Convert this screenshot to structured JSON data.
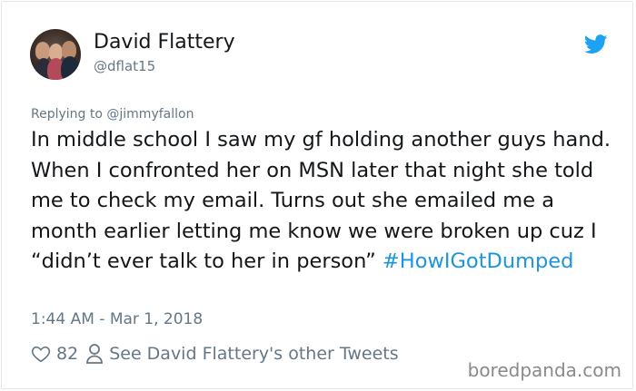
{
  "author": {
    "name": "David Flattery",
    "handle": "@dflat15"
  },
  "reply": {
    "prefix": "Replying to ",
    "mention": "@jimmyfallon"
  },
  "tweet": {
    "text": "In middle school I saw my gf holding another guys hand. When I confronted her on MSN later that night she told me to check my email. Turns out she emailed me a month earlier letting me know we were broken up cuz I “didn’t ever talk to her in person” ",
    "hashtag": "#HowIGotDumped",
    "timestamp": "1:44 AM - Mar 1, 2018"
  },
  "actions": {
    "likes": "82",
    "other_tweets_label": "See David Flattery's other Tweets"
  },
  "watermark": "boredpanda.com",
  "colors": {
    "twitter_blue": "#1da1f2",
    "hashtag": "#1b95e0",
    "secondary_text": "#657786",
    "primary_text": "#14171a"
  },
  "icons": [
    "twitter-bird-icon",
    "heart-icon",
    "person-icon"
  ]
}
